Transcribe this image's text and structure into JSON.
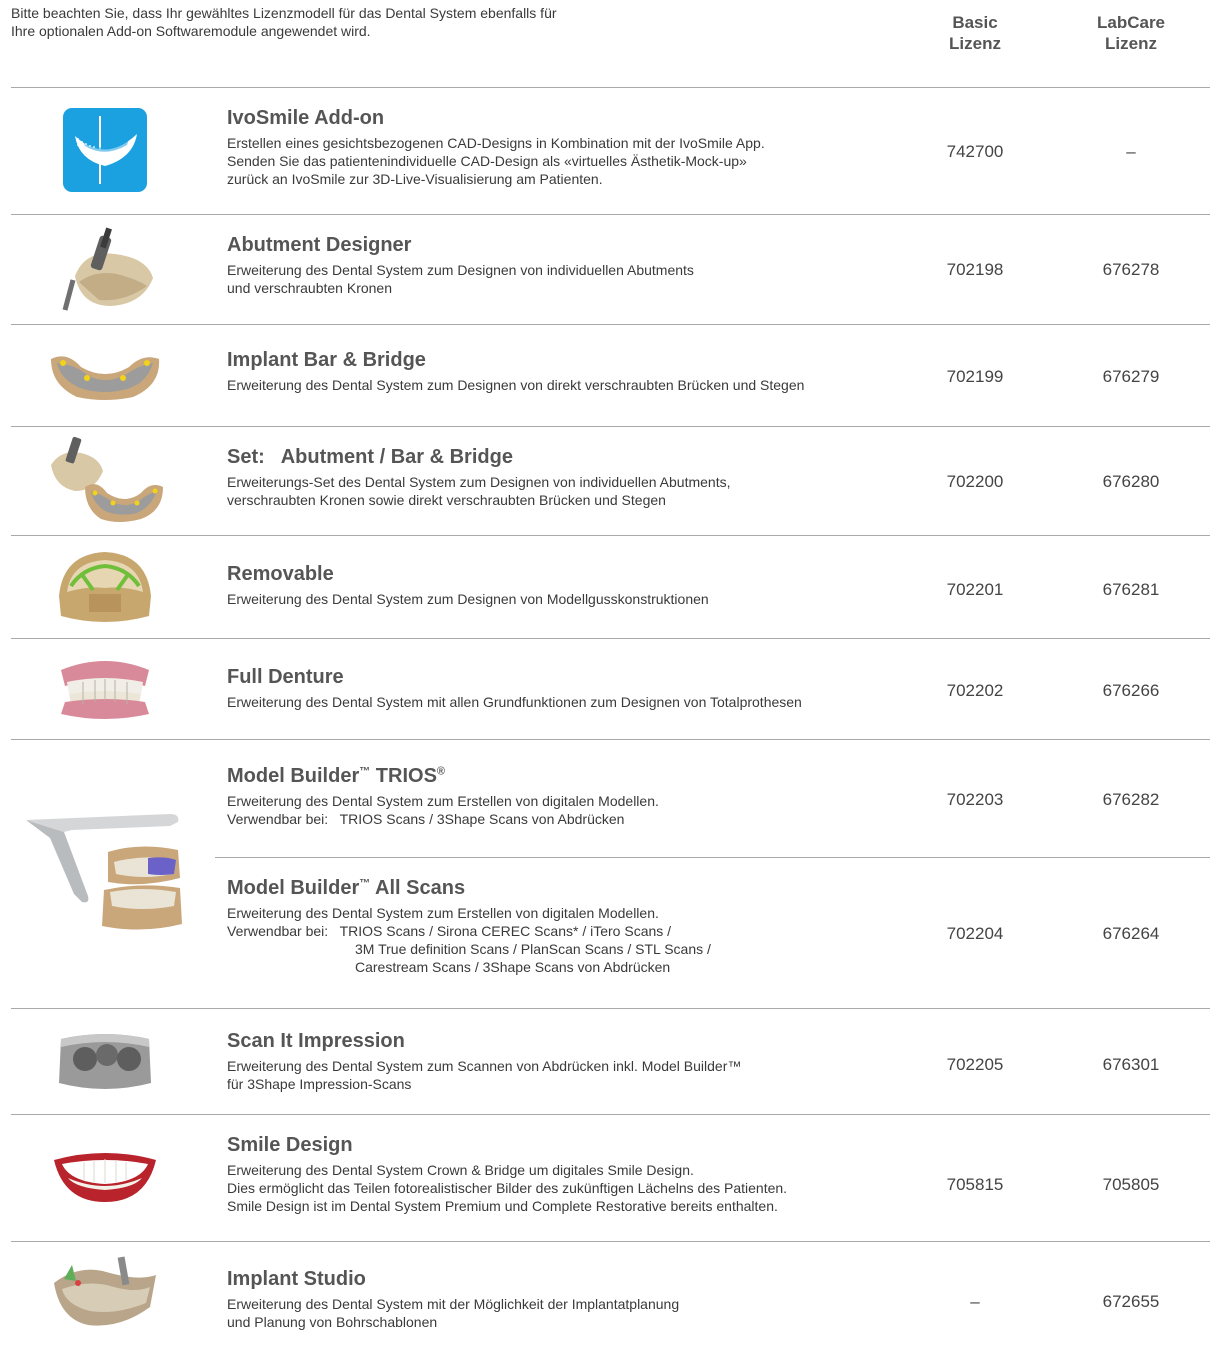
{
  "intro": {
    "line1": "Bitte beachten Sie, dass Ihr gewähltes Lizenzmodell für das Dental System ebenfalls für",
    "line2": "Ihre optionalen Add-on Softwaremodule angewendet wird."
  },
  "columns": {
    "basic": [
      "Basic",
      "Lizenz"
    ],
    "labcare": [
      "LabCare",
      "Lizenz"
    ]
  },
  "rows": [
    {
      "title": "IvoSmile Add-on",
      "lines": [
        "Erstellen eines gesichtsbezogenen CAD-Designs in Kombination mit der IvoSmile App.",
        "Senden Sie das patientenindividuelle CAD-Design als «virtuelles Ästhetik-Mock-up»",
        "zurück an IvoSmile zur 3D-Live-Visualisierung am Patienten."
      ],
      "basic": "742700",
      "labcare": "–"
    },
    {
      "title": "Abutment Designer",
      "lines": [
        "Erweiterung des Dental System zum Designen von individuellen Abutments",
        "und verschraubten Kronen"
      ],
      "basic": "702198",
      "labcare": "676278"
    },
    {
      "title": "Implant Bar & Bridge",
      "lines": [
        "Erweiterung des Dental System zum Designen von direkt verschraubten Brücken und Stegen"
      ],
      "basic": "702199",
      "labcare": "676279"
    },
    {
      "title": "Set:   Abutment / Bar & Bridge",
      "lines": [
        "Erweiterungs-Set des Dental System zum Designen von individuellen Abutments,",
        "verschraubten Kronen sowie direkt verschraubten Brücken und Stegen"
      ],
      "basic": "702200",
      "labcare": "676280"
    },
    {
      "title": "Removable",
      "lines": [
        "Erweiterung des Dental System zum Designen von Modellgusskonstruktionen"
      ],
      "basic": "702201",
      "labcare": "676281"
    },
    {
      "title": "Full Denture",
      "lines": [
        "Erweiterung des Dental System mit allen Grundfunktionen zum Designen von Totalprothesen"
      ],
      "basic": "702202",
      "labcare": "676266"
    },
    {
      "title": "Model Builder",
      "title_tm": "™",
      "title_rest": " TRIOS",
      "title_reg": "®",
      "lines": [
        "Erweiterung des Dental System zum Erstellen von digitalen Modellen.",
        "Verwendbar bei:   TRIOS Scans / 3Shape Scans von Abdrücken"
      ],
      "basic": "702203",
      "labcare": "676282"
    },
    {
      "title": "Model Builder",
      "title_tm": "™",
      "title_rest": " All Scans",
      "lines": [
        "Erweiterung des Dental System zum Erstellen von digitalen Modellen.",
        "Verwendbar bei:   TRIOS Scans / Sirona CEREC Scans* / iTero Scans /",
        "3M True definition Scans / PlanScan Scans / STL Scans /",
        "Carestream Scans / 3Shape Scans von Abdrücken"
      ],
      "basic": "702204",
      "labcare": "676264"
    },
    {
      "title": "Scan It Impression",
      "lines": [
        "Erweiterung des Dental System zum Scannen von Abdrücken inkl. Model Builder™",
        "für 3Shape Impression-Scans"
      ],
      "basic": "702205",
      "labcare": "676301"
    },
    {
      "title": "Smile Design",
      "lines": [
        "Erweiterung des Dental System Crown & Bridge um digitales Smile Design.",
        "Dies ermöglicht das Teilen fotorealistischer Bilder des zukünftigen Lächelns des Patienten.",
        "Smile Design ist im Dental System Premium und Complete Restorative bereits enthalten."
      ],
      "basic": "705815",
      "labcare": "705805"
    },
    {
      "title": "Implant Studio",
      "lines": [
        "Erweiterung des Dental System mit der Möglichkeit der Implantatplanung",
        "und Planung von Bohrschablonen"
      ],
      "basic": "–",
      "labcare": "672655"
    }
  ],
  "colors": {
    "ivosmile_blue": "#1ba0e0",
    "rule": "#a9a9a9",
    "title": "#555555"
  }
}
